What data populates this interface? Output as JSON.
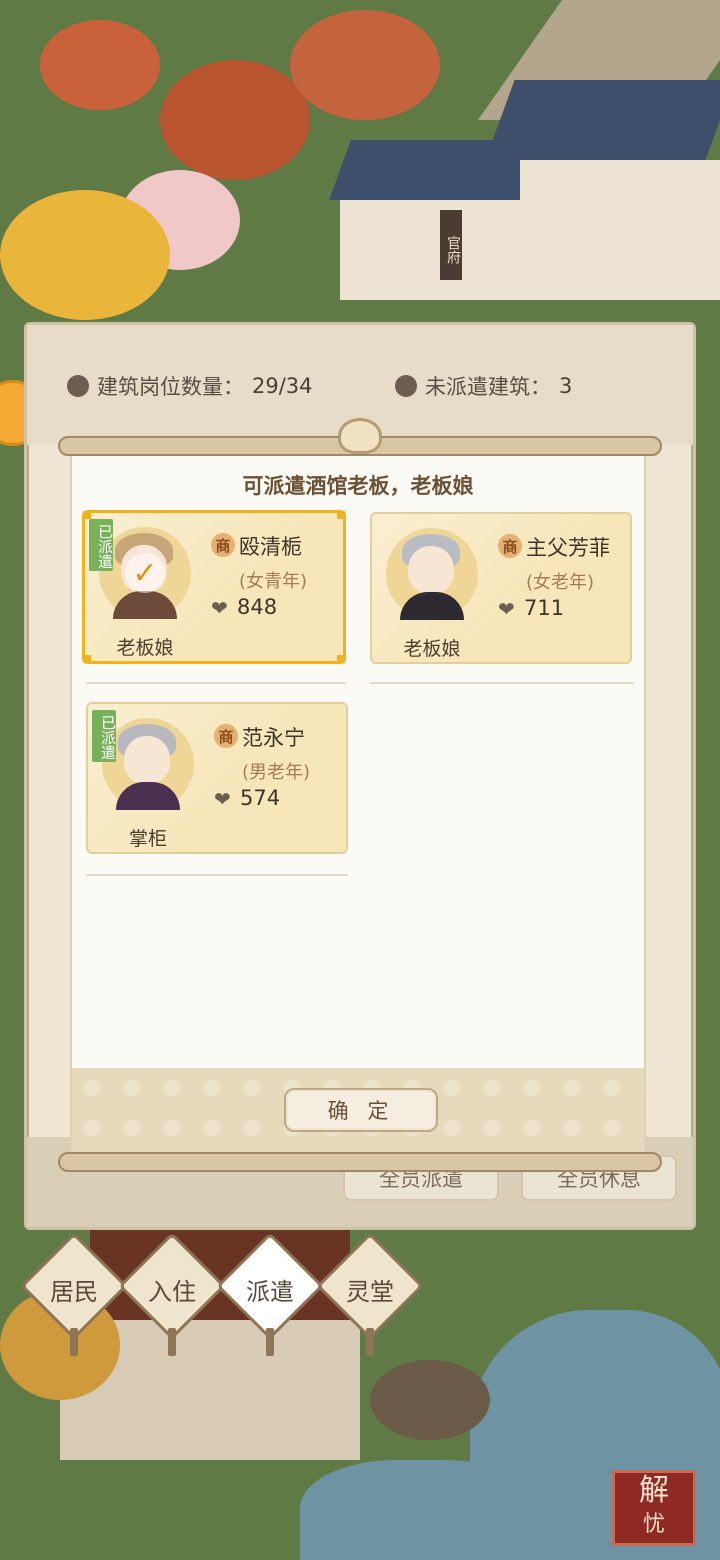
{
  "stats": {
    "positions_label": "建筑岗位数量：",
    "positions_value": "29/34",
    "undispatched_label": "未派遣建筑：",
    "undispatched_value": "3"
  },
  "dialog": {
    "title": "可派遣酒馆老板，老板娘",
    "confirm_label": "确 定"
  },
  "cards": [
    {
      "badge": "已派遣",
      "type_icon": "商",
      "name": "殴清栀",
      "category": "(女青年)",
      "score": "848",
      "role": "老板娘",
      "selected": true
    },
    {
      "badge": "",
      "type_icon": "商",
      "name": "主父芳菲",
      "category": "(女老年)",
      "score": "711",
      "role": "老板娘",
      "selected": false
    },
    {
      "badge": "已派遣",
      "type_icon": "商",
      "name": "范永宁",
      "category": "(男老年)",
      "score": "574",
      "role": "掌柜",
      "selected": false
    }
  ],
  "actions": {
    "dispatch_all": "全员派遣",
    "rest_all": "全员休息"
  },
  "tabs": [
    {
      "label": "居民"
    },
    {
      "label": "入住"
    },
    {
      "label": "派遣",
      "active": true
    },
    {
      "label": "灵堂"
    }
  ],
  "scene": {
    "sign_text": "官府",
    "seal_text_1": "解",
    "seal_text_2": "忧"
  }
}
